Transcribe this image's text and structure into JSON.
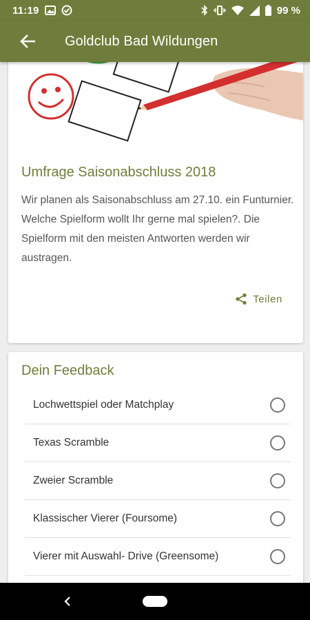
{
  "status_bar": {
    "time": "11:19",
    "battery": "99 %",
    "icons": [
      "image-icon",
      "check-circle-icon",
      "bluetooth-icon",
      "vibrate-icon",
      "wifi-icon",
      "signal-icon",
      "battery-icon"
    ]
  },
  "app_bar": {
    "title": "Goldclub Bad Wildungen",
    "back_icon": "arrow-left-icon"
  },
  "survey": {
    "title": "Umfrage Saisonabschluss 2018",
    "body": "Wir planen als Saisonabschluss am 27.10. ein Funturnier. Welche Spielform wollt Ihr gerne mal spielen?. Die Spielform mit den meisten Antworten werden wir austragen.",
    "share_label": "Teilen",
    "share_icon": "share-icon"
  },
  "feedback": {
    "title": "Dein Feedback",
    "options": [
      {
        "label": "Lochwettspiel oder Matchplay",
        "selected": false
      },
      {
        "label": "Texas Scramble",
        "selected": false
      },
      {
        "label": "Zweier Scramble",
        "selected": false
      },
      {
        "label": "Klassischer Vierer (Foursome)",
        "selected": false
      },
      {
        "label": "Vierer mit Auswahl- Drive (Greensome)",
        "selected": false
      }
    ]
  },
  "colors": {
    "accent": "#6e7d3b",
    "pencil": "#d32f2f"
  },
  "nav_bar": {
    "back_icon": "chevron-left-icon",
    "home_icon": "home-pill-icon"
  }
}
